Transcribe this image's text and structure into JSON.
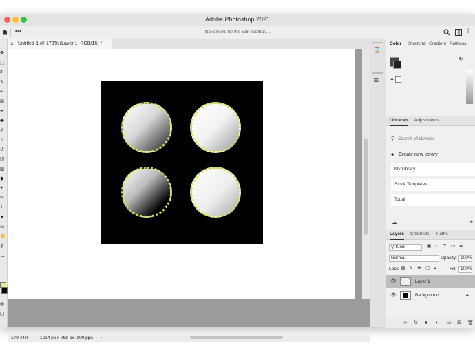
{
  "window": {
    "title": "Adobe Photoshop 2021"
  },
  "options_bar": {
    "home_icon": "home-icon",
    "message": "No options for the Edit Toolbar...."
  },
  "document": {
    "tab_label": "Untitled-1 @ 179% (Layer 1, RGB/16) *",
    "close_glyph": "×"
  },
  "status_bar": {
    "zoom": "179.44%",
    "doc_info": "1024 px x 768 px (300 ppi)",
    "arrow": "›"
  },
  "color_panel": {
    "tabs": [
      "Color",
      "Swatche:",
      "Gradient",
      "Patterns"
    ]
  },
  "libraries_panel": {
    "tabs": [
      "Libraries",
      "Adjustments"
    ],
    "search_placeholder": "Search all libraries",
    "create_label": "Create new library",
    "items": [
      "My Library",
      "Stock Templates",
      "Todai"
    ]
  },
  "layers_panel": {
    "tabs": [
      "Layers",
      "Channels",
      "Paths"
    ],
    "kind_label": "Kind",
    "blend_mode": "Normal",
    "opacity_label": "Opacity:",
    "opacity_value": "100%",
    "lock_label": "Lock:",
    "fill_label": "Fill:",
    "fill_value": "100%",
    "layers": [
      {
        "name": "Layer 1",
        "selected": true
      },
      {
        "name": "Background",
        "selected": false
      }
    ]
  },
  "colors": {
    "accent_selection": "#d6e14a",
    "selected_layer": "#bdbdbd",
    "traffic_red": "#fe5f57",
    "traffic_yellow": "#febc2e",
    "traffic_green": "#28c840"
  }
}
